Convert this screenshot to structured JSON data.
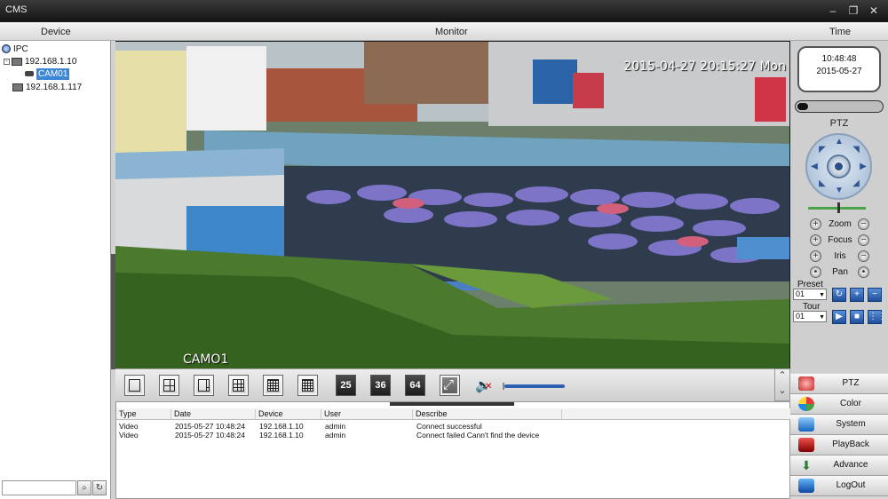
{
  "window": {
    "title": "CMS"
  },
  "header": {
    "device": "Device",
    "monitor": "Monitor",
    "time": "Time"
  },
  "device_tree": {
    "root": "IPC",
    "devices": [
      {
        "label": "192.168.1.10",
        "expanded": true,
        "children": [
          "CAM01"
        ]
      },
      {
        "label": "192.168.1.117"
      }
    ],
    "selected": "CAM01"
  },
  "video": {
    "osd_time": "2015-04-27 20:15:27 Mon",
    "osd_camera": "CAMO1"
  },
  "layout_toolbar": {
    "layouts": [
      "1",
      "4",
      "6",
      "9",
      "13",
      "16"
    ],
    "number_buttons": [
      "25",
      "36",
      "64"
    ]
  },
  "log": {
    "columns": [
      "Type",
      "Date",
      "Device",
      "User",
      "Describe"
    ],
    "rows": [
      {
        "type": "Video",
        "date": "2015-05-27 10:48:24",
        "device": "192.168.1.10",
        "user": "admin",
        "describe": "Connect successful"
      },
      {
        "type": "Video",
        "date": "2015-05-27 10:48:24",
        "device": "192.168.1.10",
        "user": "admin",
        "describe": "Connect failed Cann't find the device"
      }
    ]
  },
  "clock": {
    "time": "10:48:48",
    "date": "2015-05-27"
  },
  "ptz": {
    "title": "PTZ",
    "controls": [
      "Zoom",
      "Focus",
      "Iris",
      "Pan"
    ],
    "preset_label": "Preset",
    "preset_value": "01",
    "tour_label": "Tour",
    "tour_value": "01"
  },
  "menu": {
    "items": [
      {
        "label": "PTZ",
        "color": "#c62828"
      },
      {
        "label": "Color",
        "color": "#2e7d32"
      },
      {
        "label": "System",
        "color": "#1565c0"
      },
      {
        "label": "PlayBack",
        "color": "#b71c1c"
      },
      {
        "label": "Advance",
        "color": "#2e7d32"
      },
      {
        "label": "LogOut",
        "color": "#0d47a1"
      }
    ]
  },
  "colors": {
    "accent": "#3b86d6",
    "progress": "#2e5fb0"
  }
}
